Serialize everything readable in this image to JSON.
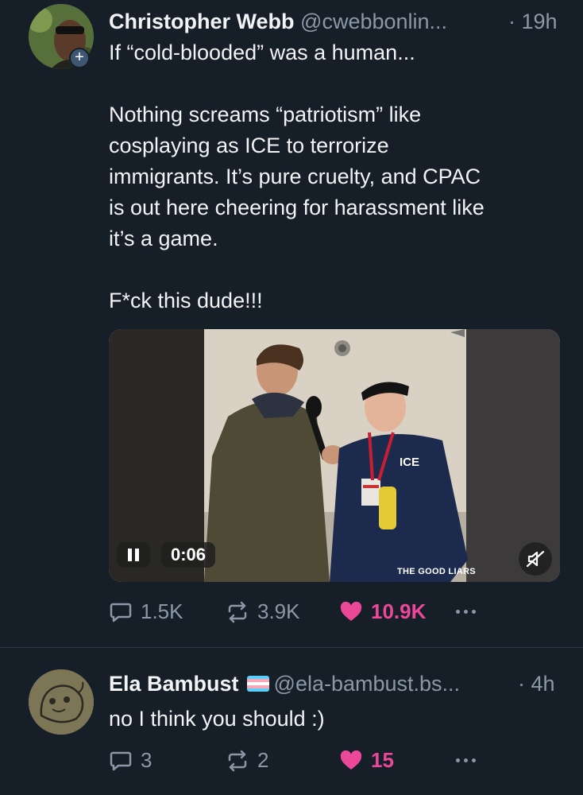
{
  "post": {
    "author_name": "Christopher Webb",
    "author_handle": "@cwebbonlin...",
    "time": "· 19h",
    "follow_icon": "+",
    "text_lines": [
      "If “cold-blooded” was a human...",
      "",
      "Nothing screams “patriotism” like",
      "cosplaying as ICE to terrorize",
      "immigrants. It’s pure cruelty, and CPAC",
      "is out here cheering for harassment like",
      "it’s a game.",
      "",
      "F*ck this dude!!!"
    ],
    "video": {
      "timecode": "0:06",
      "watermark": "THE GOOD LIARS",
      "jacket_text": "ICE",
      "state": "playing",
      "muted": true
    },
    "actions": {
      "replies": "1.5K",
      "reposts": "3.9K",
      "likes": "10.9K",
      "liked": true
    }
  },
  "reply": {
    "author_name": "Ela Bambust",
    "author_handle": "@ela-bambust.bs...",
    "time": "· 4h",
    "text": "no I think you should :)",
    "actions": {
      "replies": "3",
      "reposts": "2",
      "likes": "15",
      "liked": true
    }
  },
  "colors": {
    "background": "#161e27",
    "text": "#f1f3f5",
    "muted": "#8b98a8",
    "like": "#ec4899"
  }
}
